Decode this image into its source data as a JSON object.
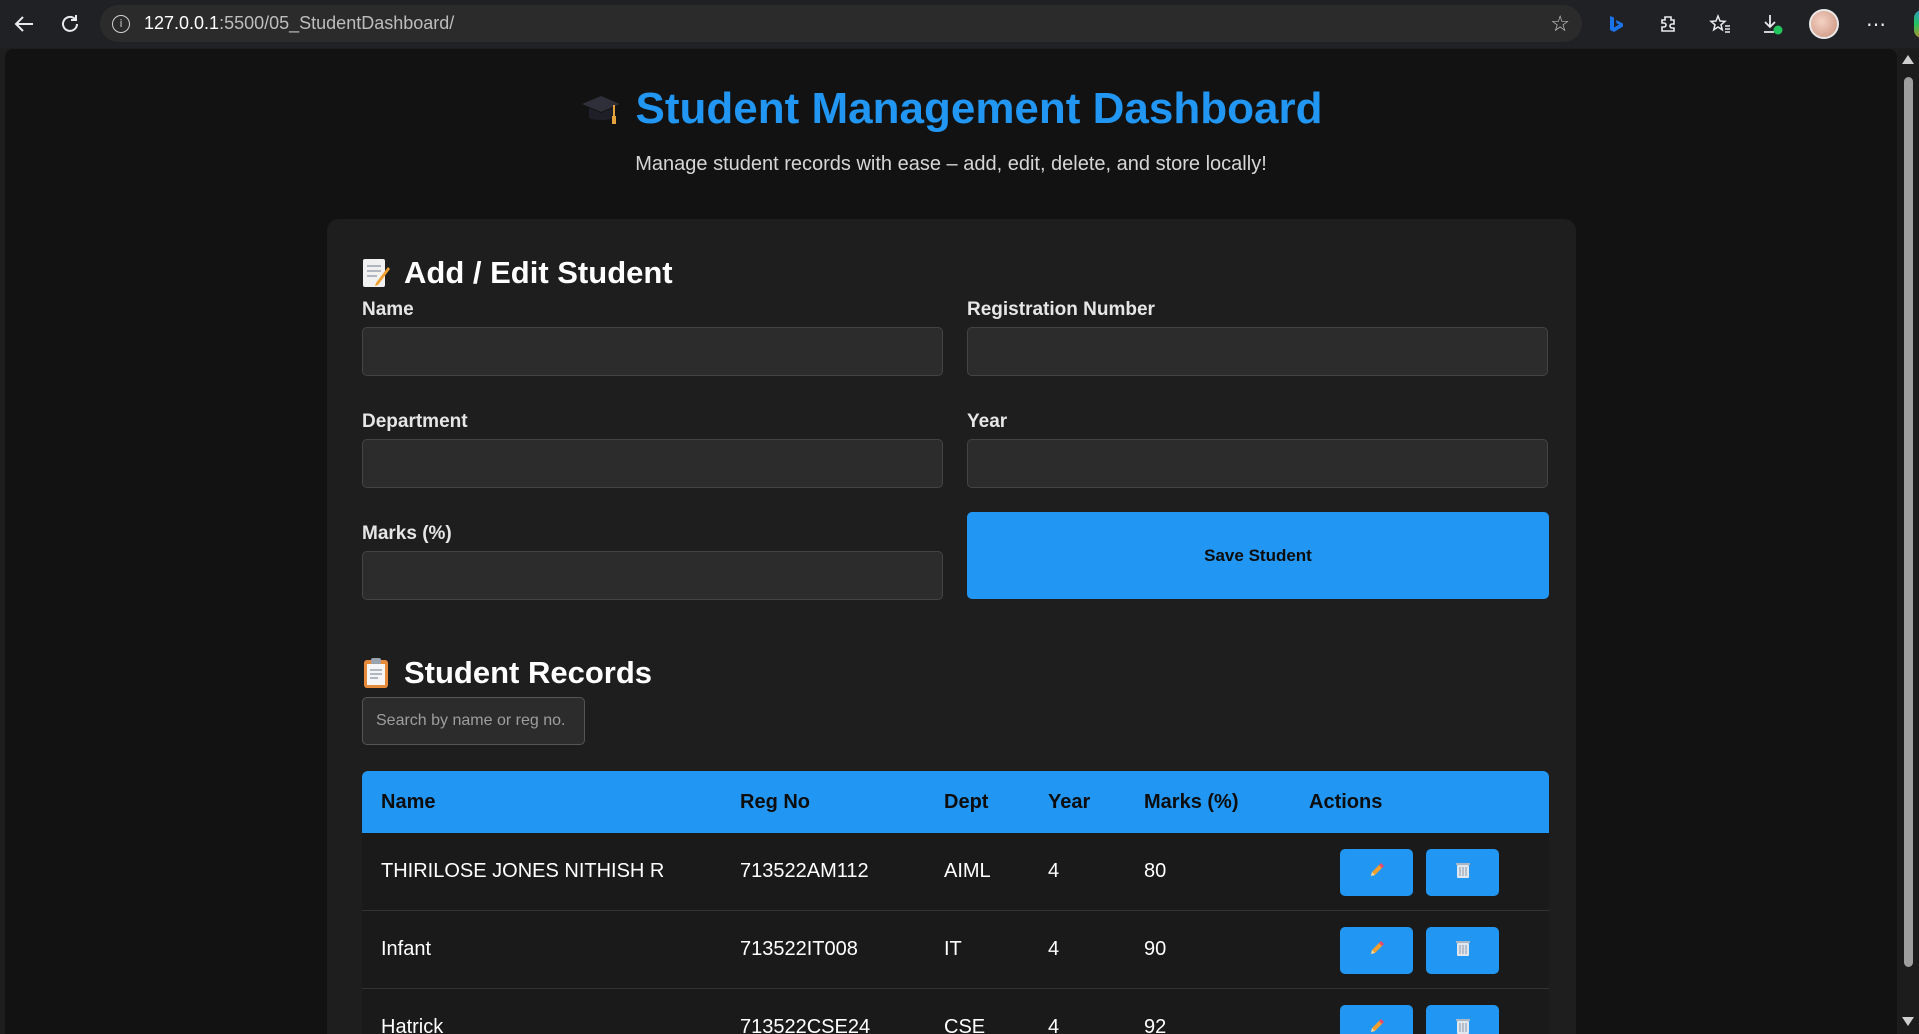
{
  "browser": {
    "url_host": "127.0.0.1",
    "url_path": ":5500/05_StudentDashboard/"
  },
  "header": {
    "title": "Student Management Dashboard",
    "subtitle": "Manage student records with ease – add, edit, delete, and store locally!"
  },
  "form": {
    "section_title": "Add / Edit Student",
    "name_label": "Name",
    "regno_label": "Registration Number",
    "dept_label": "Department",
    "year_label": "Year",
    "marks_label": "Marks (%)",
    "name_value": "",
    "regno_value": "",
    "dept_value": "",
    "year_value": "",
    "marks_value": "",
    "save_label": "Save Student"
  },
  "records": {
    "section_title": "Student Records",
    "search_placeholder": "Search by name or reg no.",
    "columns": [
      "Name",
      "Reg No",
      "Dept",
      "Year",
      "Marks (%)",
      "Actions"
    ],
    "rows": [
      {
        "name": "THIRILOSE JONES NITHISH R",
        "reg": "713522AM112",
        "dept": "AIML",
        "year": "4",
        "marks": "80"
      },
      {
        "name": "Infant",
        "reg": "713522IT008",
        "dept": "IT",
        "year": "4",
        "marks": "90"
      },
      {
        "name": "Hatrick",
        "reg": "713522CSE24",
        "dept": "CSE",
        "year": "4",
        "marks": "92"
      }
    ]
  },
  "colors": {
    "accent": "#2196f3",
    "background": "#121212",
    "card": "#1e1e1e"
  }
}
